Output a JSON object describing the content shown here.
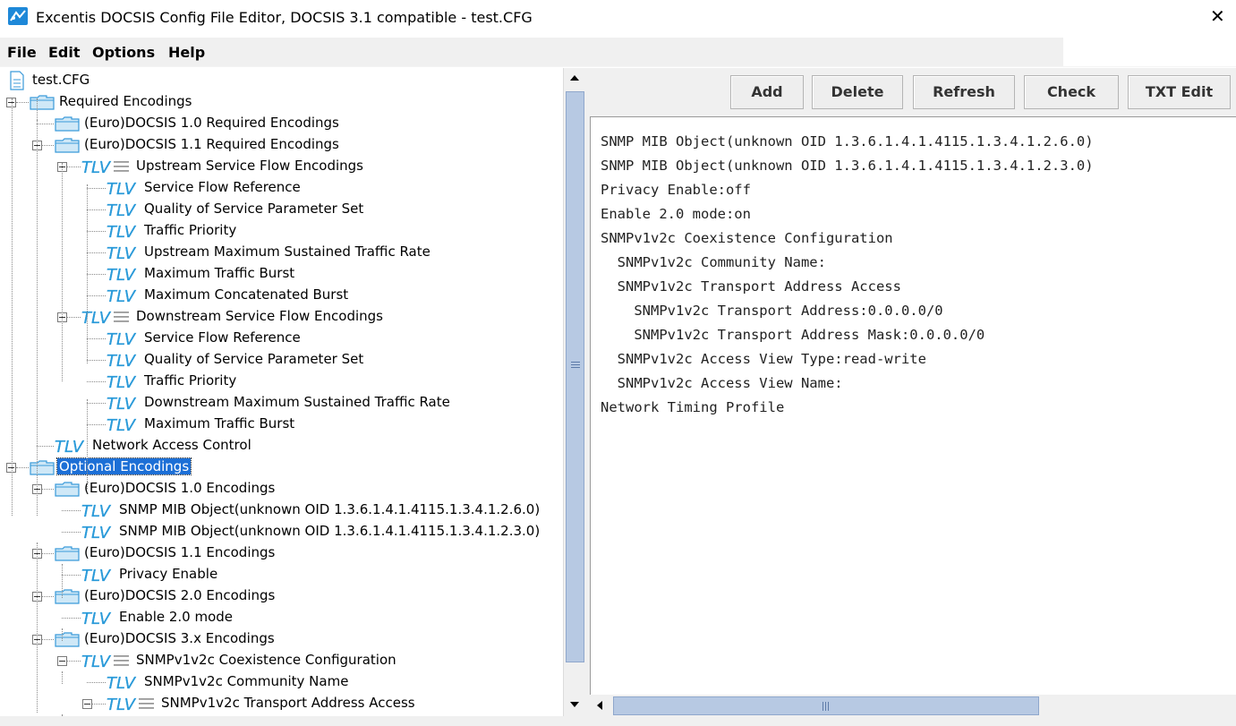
{
  "window": {
    "title": "Excentis DOCSIS Config File Editor, DOCSIS 3.1 compatible - test.CFG",
    "close_glyph": "✕"
  },
  "menu": [
    "File",
    "Edit",
    "Options",
    "Help"
  ],
  "toolbar": {
    "add": "Add",
    "delete": "Delete",
    "refresh": "Refresh",
    "check": "Check",
    "txt_edit": "TXT Edit"
  },
  "tree": [
    {
      "label": "test.CFG",
      "icon": "doc-icon"
    },
    {
      "label": "Required Encodings",
      "icon": "folder-icon"
    },
    {
      "label": "(Euro)DOCSIS 1.0 Required Encodings",
      "icon": "folder-icon"
    },
    {
      "label": "(Euro)DOCSIS 1.1 Required Encodings",
      "icon": "folder-icon"
    },
    {
      "label": "Upstream Service Flow Encodings",
      "icon": "tlv-branch-icon"
    },
    {
      "label": "Service Flow Reference",
      "icon": "tlv-icon"
    },
    {
      "label": "Quality of Service Parameter Set",
      "icon": "tlv-icon"
    },
    {
      "label": "Traffic Priority",
      "icon": "tlv-icon"
    },
    {
      "label": "Upstream Maximum Sustained Traffic Rate",
      "icon": "tlv-icon"
    },
    {
      "label": "Maximum Traffic Burst",
      "icon": "tlv-icon"
    },
    {
      "label": "Maximum Concatenated Burst",
      "icon": "tlv-icon"
    },
    {
      "label": "Downstream Service Flow Encodings",
      "icon": "tlv-branch-icon"
    },
    {
      "label": "Service Flow Reference",
      "icon": "tlv-icon"
    },
    {
      "label": "Quality of Service Parameter Set",
      "icon": "tlv-icon"
    },
    {
      "label": "Traffic Priority",
      "icon": "tlv-icon"
    },
    {
      "label": "Downstream Maximum Sustained Traffic Rate",
      "icon": "tlv-icon"
    },
    {
      "label": "Maximum Traffic Burst",
      "icon": "tlv-icon"
    },
    {
      "label": "Network Access Control",
      "icon": "tlv-icon"
    },
    {
      "label": "Optional Encodings",
      "icon": "folder-icon",
      "selected": true
    },
    {
      "label": "(Euro)DOCSIS 1.0 Encodings",
      "icon": "folder-icon"
    },
    {
      "label": "SNMP MIB Object(unknown OID 1.3.6.1.4.1.4115.1.3.4.1.2.6.0)",
      "icon": "tlv-icon"
    },
    {
      "label": "SNMP MIB Object(unknown OID 1.3.6.1.4.1.4115.1.3.4.1.2.3.0)",
      "icon": "tlv-icon"
    },
    {
      "label": "(Euro)DOCSIS 1.1 Encodings",
      "icon": "folder-icon"
    },
    {
      "label": "Privacy Enable",
      "icon": "tlv-icon"
    },
    {
      "label": "(Euro)DOCSIS 2.0 Encodings",
      "icon": "folder-icon"
    },
    {
      "label": "Enable 2.0 mode",
      "icon": "tlv-icon"
    },
    {
      "label": "(Euro)DOCSIS 3.x Encodings",
      "icon": "folder-icon"
    },
    {
      "label": "SNMPv1v2c Coexistence Configuration",
      "icon": "tlv-branch-icon"
    },
    {
      "label": "SNMPv1v2c Community Name",
      "icon": "tlv-icon"
    },
    {
      "label": "SNMPv1v2c Transport Address Access",
      "icon": "tlv-branch-icon"
    }
  ],
  "text_lines": [
    "SNMP MIB Object(unknown OID 1.3.6.1.4.1.4115.1.3.4.1.2.6.0)",
    "SNMP MIB Object(unknown OID 1.3.6.1.4.1.4115.1.3.4.1.2.3.0)",
    "Privacy Enable:off",
    "Enable 2.0 mode:on",
    "SNMPv1v2c Coexistence Configuration",
    "  SNMPv1v2c Community Name:",
    "  SNMPv1v2c Transport Address Access",
    "    SNMPv1v2c Transport Address:0.0.0.0/0",
    "    SNMPv1v2c Transport Address Mask:0.0.0.0/0",
    "  SNMPv1v2c Access View Type:read-write",
    "  SNMPv1v2c Access View Name:",
    "Network Timing Profile"
  ]
}
